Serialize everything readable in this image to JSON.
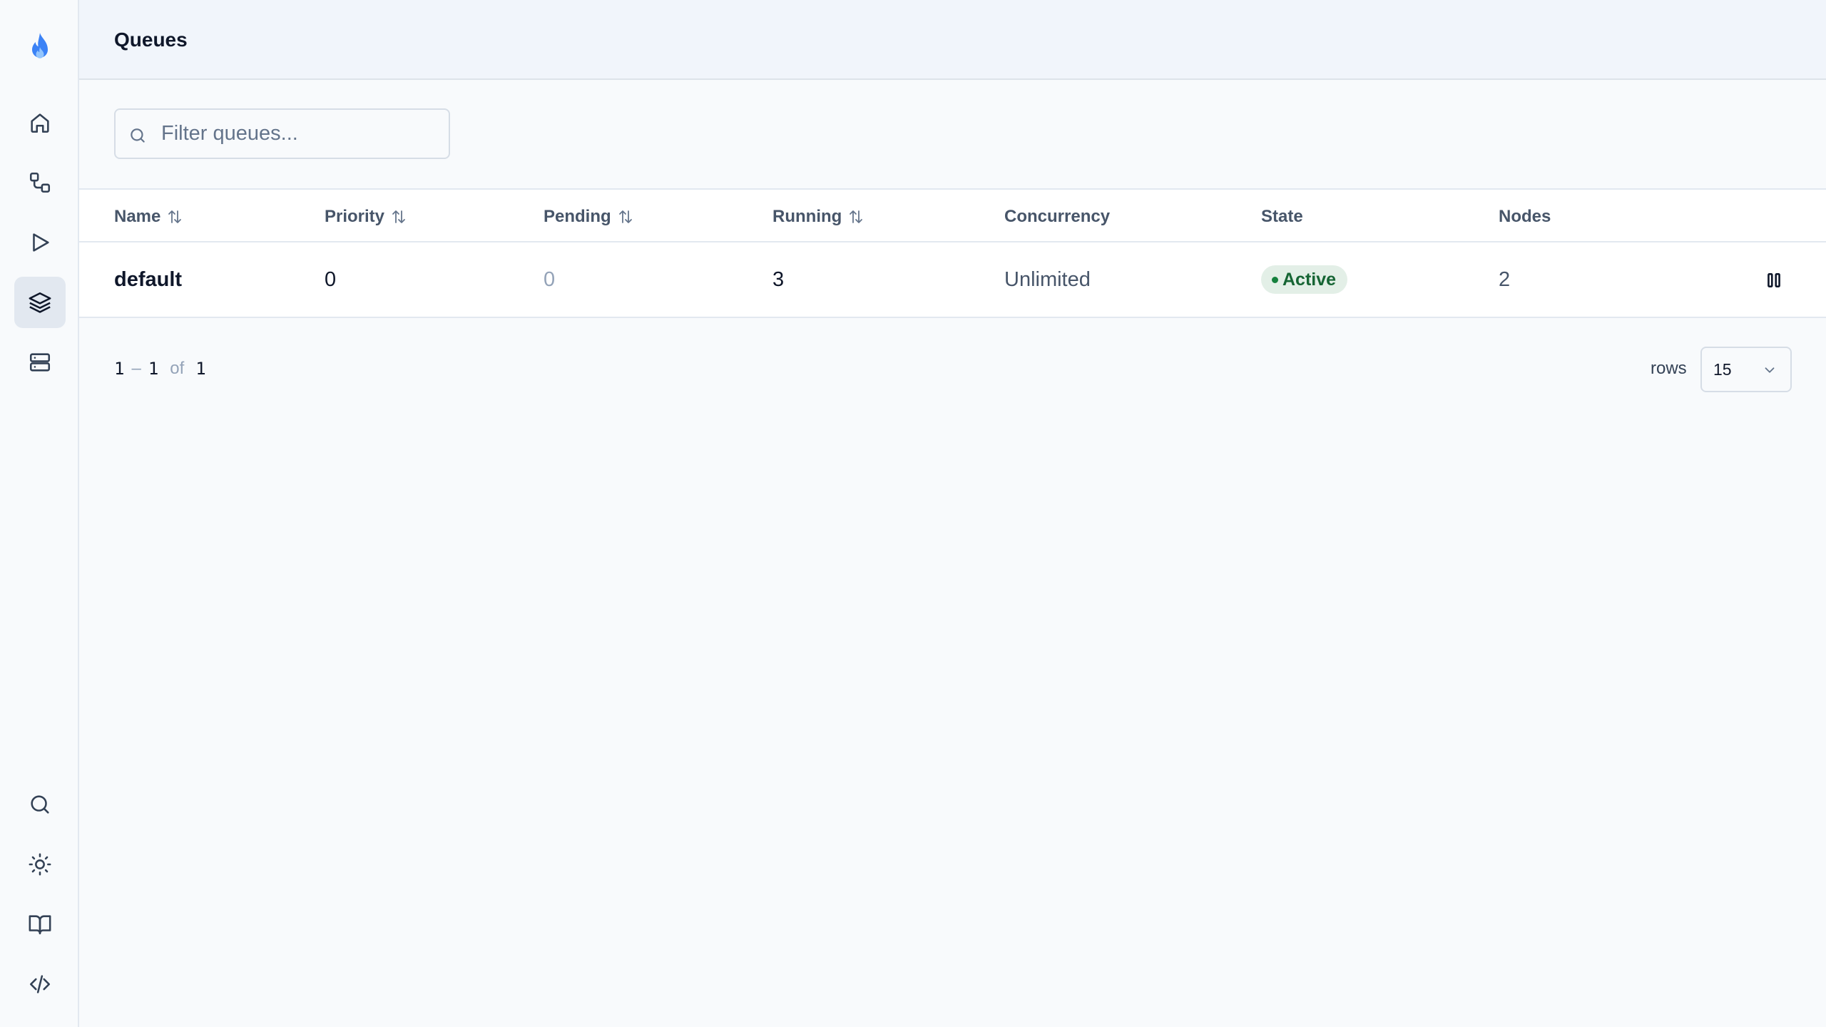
{
  "header": {
    "title": "Queues"
  },
  "filter": {
    "placeholder": "Filter queues..."
  },
  "table": {
    "columns": [
      "Name",
      "Priority",
      "Pending",
      "Running",
      "Concurrency",
      "State",
      "Nodes"
    ],
    "rows": [
      {
        "name": "default",
        "priority": "0",
        "pending": "0",
        "running": "3",
        "concurrency": "Unlimited",
        "state": "Active",
        "nodes": "2"
      }
    ]
  },
  "pagination": {
    "start": "1",
    "sep": "–",
    "end": "1",
    "of": "of",
    "total": "1",
    "rows_label": "rows",
    "rows_value": "15"
  },
  "sidebar": {
    "items": [
      "home-icon",
      "workflow-icon",
      "play-icon",
      "layers-icon",
      "server-icon"
    ],
    "bottom": [
      "search-icon",
      "sun-icon",
      "book-icon",
      "code-icon"
    ]
  },
  "colors": {
    "accent": "#3b82f6",
    "active_badge_bg": "#e3efe7",
    "active_badge_text": "#166534"
  }
}
